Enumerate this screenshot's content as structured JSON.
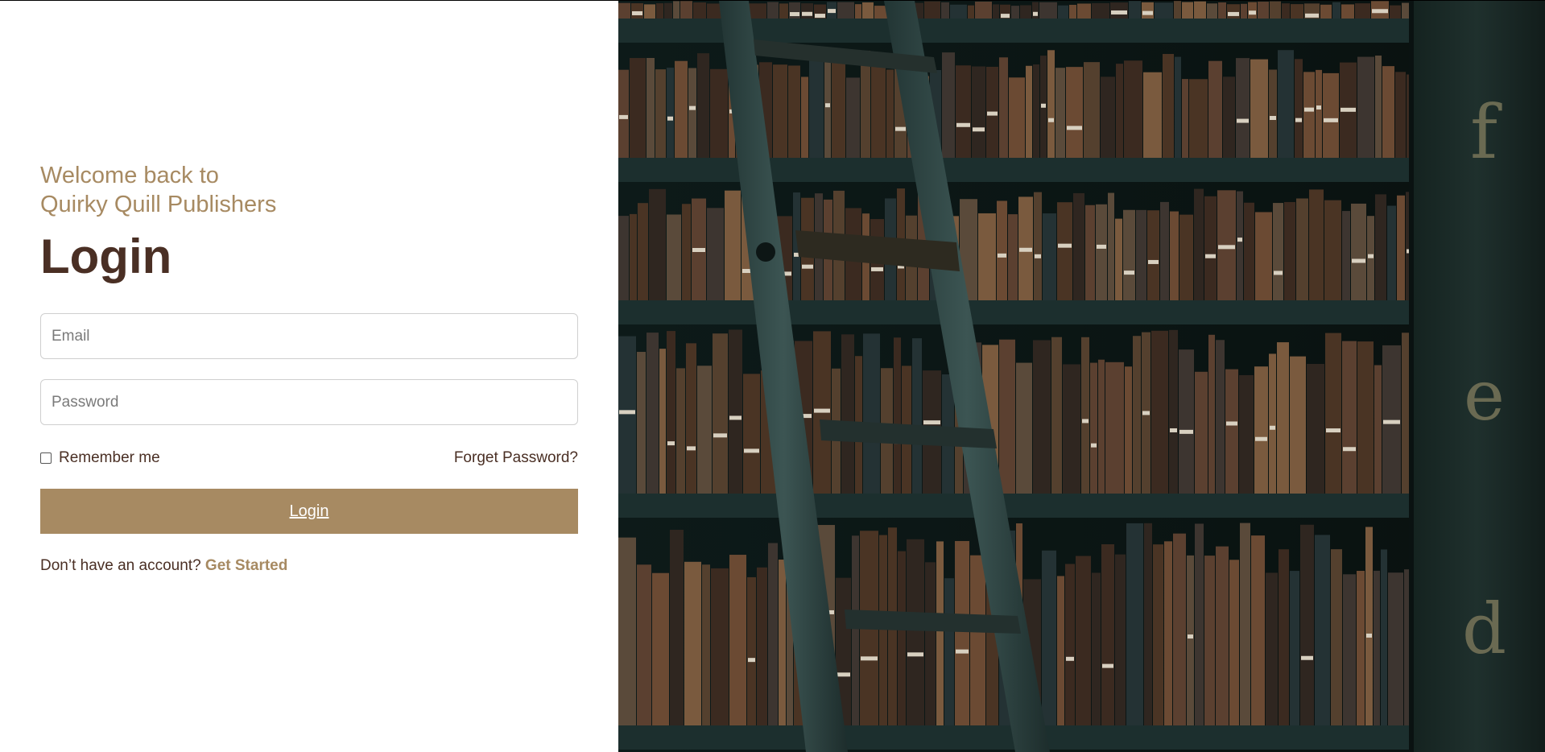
{
  "welcome": {
    "line1": "Welcome back to",
    "line2": "Quirky Quill Publishers"
  },
  "heading": "Login",
  "form": {
    "email_placeholder": "Email",
    "email_value": "",
    "password_placeholder": "Password",
    "password_value": "",
    "remember_label": "Remember me",
    "remember_checked": false,
    "forgot_label": "Forget Password?",
    "submit_label": "Login"
  },
  "signup": {
    "prompt": "Don’t have an account?",
    "link": "Get Started"
  },
  "hero": {
    "image_name": "library-bookshelf-ladder-image",
    "spine_letters": [
      "f",
      "e",
      "d"
    ]
  },
  "colors": {
    "accent": "#a78a62",
    "heading": "#4a2f24",
    "shelf": "#1c2f2e"
  }
}
